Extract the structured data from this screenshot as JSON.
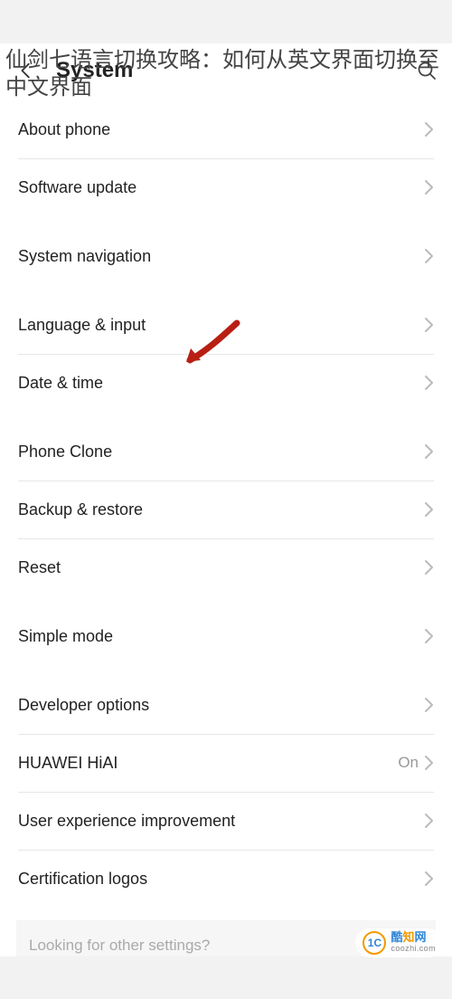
{
  "overlay_title": "仙剑七语言切换攻略：如何从英文界面切换至中文界面",
  "header": {
    "title": "System"
  },
  "groups": [
    {
      "rows": [
        {
          "label": "About phone",
          "value": ""
        },
        {
          "label": "Software update",
          "value": ""
        }
      ]
    },
    {
      "rows": [
        {
          "label": "System navigation",
          "value": ""
        }
      ]
    },
    {
      "rows": [
        {
          "label": "Language & input",
          "value": "",
          "highlighted": true
        },
        {
          "label": "Date & time",
          "value": ""
        }
      ]
    },
    {
      "rows": [
        {
          "label": "Phone Clone",
          "value": ""
        },
        {
          "label": "Backup & restore",
          "value": ""
        },
        {
          "label": "Reset",
          "value": ""
        }
      ]
    },
    {
      "rows": [
        {
          "label": "Simple mode",
          "value": ""
        }
      ]
    },
    {
      "rows": [
        {
          "label": "Developer options",
          "value": ""
        },
        {
          "label": "HUAWEI HiAI",
          "value": "On"
        },
        {
          "label": "User experience improvement",
          "value": ""
        },
        {
          "label": "Certification logos",
          "value": ""
        }
      ]
    }
  ],
  "footer_hint": "Looking for other settings?",
  "watermark": {
    "brand_cn": "酷知网",
    "domain": "coozhi.com",
    "badge": "1C"
  }
}
